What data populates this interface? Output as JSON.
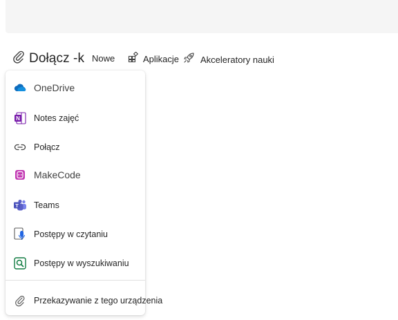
{
  "toolbar": {
    "attach_label": "Dołącz -k",
    "new_label": "Nowe",
    "apps_label": "Aplikacje",
    "accelerators_label": "Akceleratory nauki"
  },
  "menu": {
    "items": [
      {
        "label": "OneDrive",
        "icon": "onedrive-icon"
      },
      {
        "label": "Notes zajęć",
        "icon": "onenote-class-notebook-icon"
      },
      {
        "label": "Połącz",
        "icon": "link-icon"
      },
      {
        "label": "MakeCode",
        "icon": "makecode-icon"
      },
      {
        "label": "Teams",
        "icon": "teams-icon"
      },
      {
        "label": "Postępy w czytaniu",
        "icon": "reading-progress-icon"
      },
      {
        "label": "Postępy w wyszukiwaniu",
        "icon": "search-progress-icon"
      }
    ],
    "upload_label": "Przekazywanie z tego urządzenia"
  },
  "colors": {
    "onedrive": "#0f6cbd",
    "onenote": "#7719aa",
    "makecode": "#c239b3",
    "teams": "#5b5fc7",
    "reading_progress": "#2266e3",
    "search_progress": "#107c41"
  }
}
